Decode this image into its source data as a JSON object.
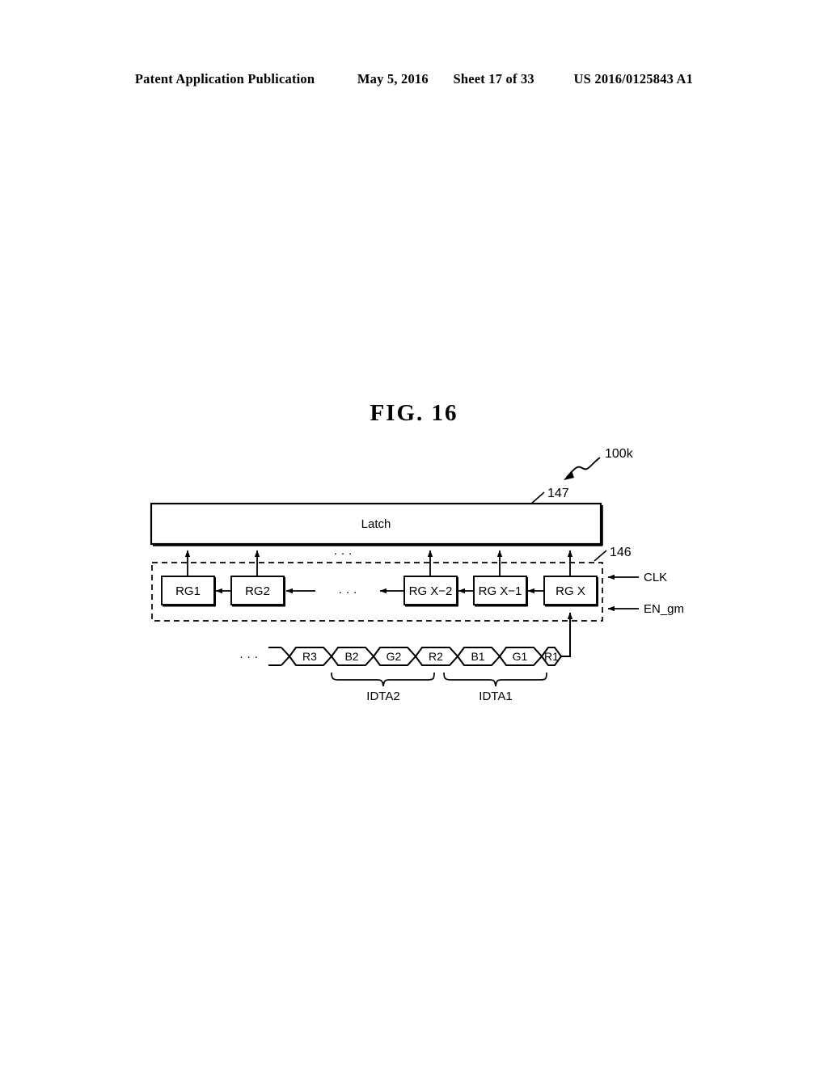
{
  "header": {
    "publication": "Patent Application Publication",
    "date": "May 5, 2016",
    "sheet": "Sheet 17 of 33",
    "patent_number": "US 2016/0125843 A1"
  },
  "figure": {
    "title": "FIG.  16",
    "callouts": {
      "device": "100k",
      "latch_ref": "147",
      "register_block_ref": "146"
    },
    "latch": {
      "label": "Latch"
    },
    "registers": [
      {
        "label": "RG1"
      },
      {
        "label": "RG2"
      },
      {
        "label": "RG X−2"
      },
      {
        "label": "RG X−1"
      },
      {
        "label": "RG X"
      }
    ],
    "ellipsis": "·  ·  ·",
    "signals": [
      {
        "label": "CLK"
      },
      {
        "label": "EN_gm"
      }
    ],
    "data_stream": {
      "lead_ellipsis": "· · ·",
      "cells": [
        "R3",
        "B2",
        "G2",
        "R2",
        "B1",
        "G1",
        "R1"
      ]
    },
    "groups": [
      {
        "label": "IDTA2"
      },
      {
        "label": "IDTA1"
      }
    ]
  },
  "colors": {
    "ink": "#000000",
    "paper": "#ffffff"
  }
}
